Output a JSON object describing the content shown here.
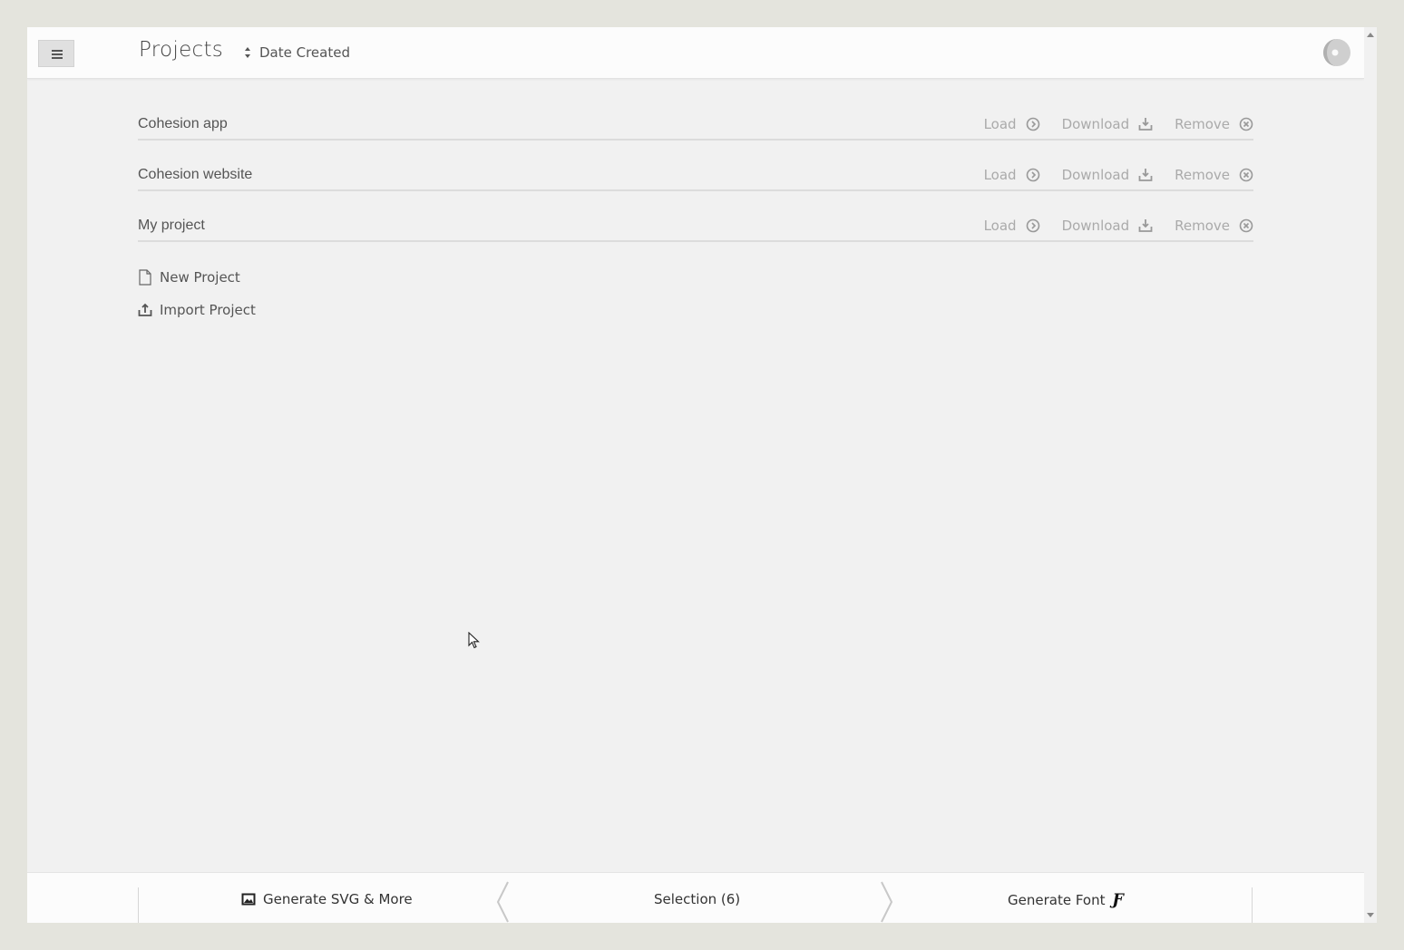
{
  "header": {
    "menu_icon": "hamburger-icon",
    "title": "Projects",
    "sort_label": "Date Created",
    "sort_icon": "sort-icon",
    "logo_icon": "app-logo-icon"
  },
  "projects": [
    {
      "name": "Cohesion app",
      "load": "Load",
      "download": "Download",
      "remove": "Remove"
    },
    {
      "name": "Cohesion website",
      "load": "Load",
      "download": "Download",
      "remove": "Remove"
    },
    {
      "name": "My project",
      "load": "Load",
      "download": "Download",
      "remove": "Remove"
    }
  ],
  "actions": {
    "new_project": "New Project",
    "import_project": "Import Project"
  },
  "footer": {
    "generate_svg": "Generate SVG & More",
    "selection": "Selection (6)",
    "generate_font": "Generate Font",
    "font_glyph": "Ƒ"
  },
  "colors": {
    "background": "#e4e4dd",
    "panel": "#f1f1f1",
    "bar": "#fcfcfc",
    "action_text": "#aaaaaa",
    "text": "#555555"
  }
}
